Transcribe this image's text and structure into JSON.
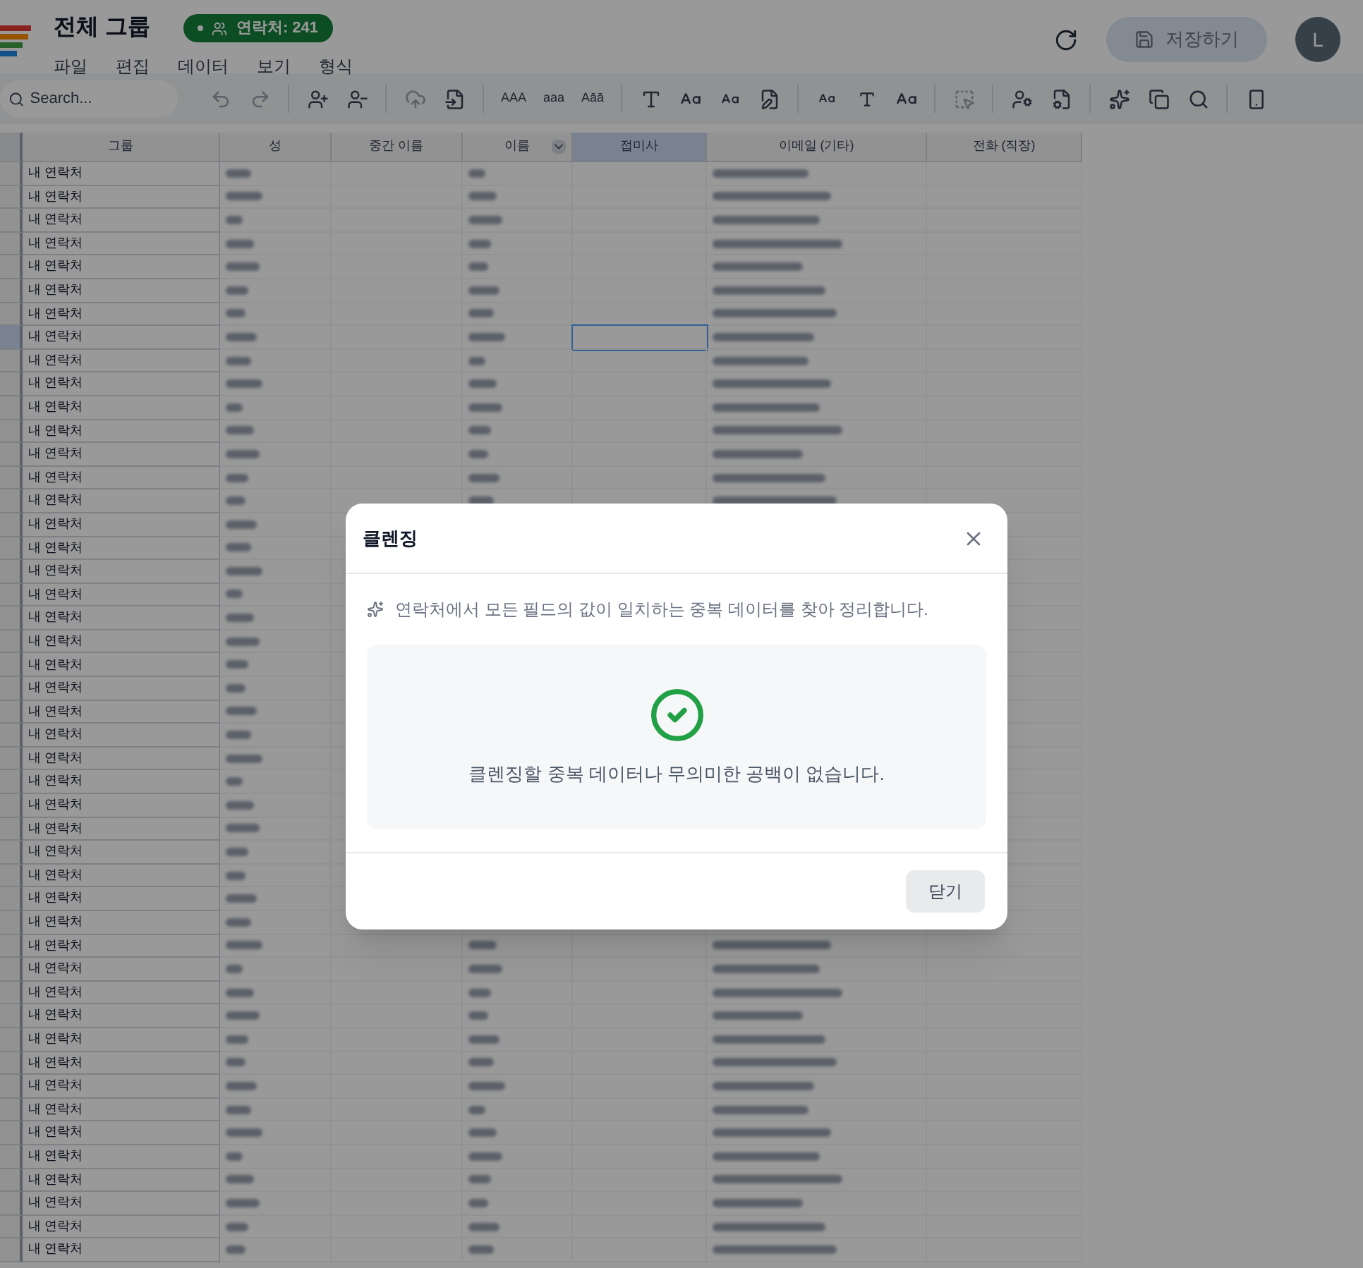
{
  "app": {
    "title": "전체 그룹",
    "badge": "연락처: 241",
    "menu": [
      "파일",
      "편집",
      "데이터",
      "보기",
      "형식"
    ],
    "save_button": {
      "label": "저장하기",
      "disabled": true
    },
    "avatar": "L"
  },
  "toolbar": {
    "search": {
      "placeholder": "Search..."
    },
    "case_buttons": [
      "AAA",
      "aaa",
      "Aāā"
    ]
  },
  "table": {
    "columns": [
      {
        "label": "그룹",
        "selected": false
      },
      {
        "label": "성",
        "selected": false
      },
      {
        "label": "중간 이름",
        "selected": false
      },
      {
        "label": "이름",
        "selected": false
      },
      {
        "label": "접미사",
        "selected": true
      },
      {
        "label": "이메일 (기타)",
        "selected": false
      },
      {
        "label": "전화 (직장)",
        "selected": false
      }
    ],
    "rows": [
      {
        "group": "내 연락처",
        "selected": false
      },
      {
        "group": "내 연락처",
        "selected": false
      },
      {
        "group": "내 연락처",
        "selected": false
      },
      {
        "group": "내 연락처",
        "selected": false
      },
      {
        "group": "내 연락처",
        "selected": false
      },
      {
        "group": "내 연락처",
        "selected": false
      },
      {
        "group": "내 연락처",
        "selected": false
      },
      {
        "group": "내 연락처",
        "selected": true
      },
      {
        "group": "내 연락처",
        "selected": false
      },
      {
        "group": "내 연락처",
        "selected": false
      },
      {
        "group": "내 연락처",
        "selected": false
      },
      {
        "group": "내 연락처",
        "selected": false
      },
      {
        "group": "내 연락처",
        "selected": false
      },
      {
        "group": "내 연락처",
        "selected": false
      },
      {
        "group": "내 연락처",
        "selected": false
      },
      {
        "group": "내 연락처",
        "selected": false
      },
      {
        "group": "내 연락처",
        "selected": false
      },
      {
        "group": "내 연락처",
        "selected": false
      },
      {
        "group": "내 연락처",
        "selected": false
      },
      {
        "group": "내 연락처",
        "selected": false
      },
      {
        "group": "내 연락처",
        "selected": false
      },
      {
        "group": "내 연락처",
        "selected": false
      },
      {
        "group": "내 연락처",
        "selected": false
      },
      {
        "group": "내 연락처",
        "selected": false
      },
      {
        "group": "내 연락처",
        "selected": false
      },
      {
        "group": "내 연락처",
        "selected": false
      },
      {
        "group": "내 연락처",
        "selected": false
      },
      {
        "group": "내 연락처",
        "selected": false
      },
      {
        "group": "내 연락처",
        "selected": false
      },
      {
        "group": "내 연락처",
        "selected": false
      },
      {
        "group": "내 연락처",
        "selected": false
      },
      {
        "group": "내 연락처",
        "selected": false
      },
      {
        "group": "내 연락처",
        "selected": false
      },
      {
        "group": "내 연락처",
        "selected": false
      },
      {
        "group": "내 연락처",
        "selected": false
      },
      {
        "group": "내 연락처",
        "selected": false
      },
      {
        "group": "내 연락처",
        "selected": false
      },
      {
        "group": "내 연락처",
        "selected": false
      },
      {
        "group": "내 연락처",
        "selected": false
      },
      {
        "group": "내 연락처",
        "selected": false
      },
      {
        "group": "내 연락처",
        "selected": false
      },
      {
        "group": "내 연락처",
        "selected": false
      },
      {
        "group": "내 연락처",
        "selected": false
      },
      {
        "group": "내 연락처",
        "selected": false
      },
      {
        "group": "내 연락처",
        "selected": false
      },
      {
        "group": "내 연락처",
        "selected": false
      },
      {
        "group": "내 연락처",
        "selected": false
      }
    ]
  },
  "dialog": {
    "title": "클렌징",
    "description": "연락처에서 모든 필드의 값이 일치하는 중복 데이터를 찾아 정리합니다.",
    "message": "클렌징할 중복 데이터나 무의미한 공백이 없습니다.",
    "close_button": "닫기"
  }
}
